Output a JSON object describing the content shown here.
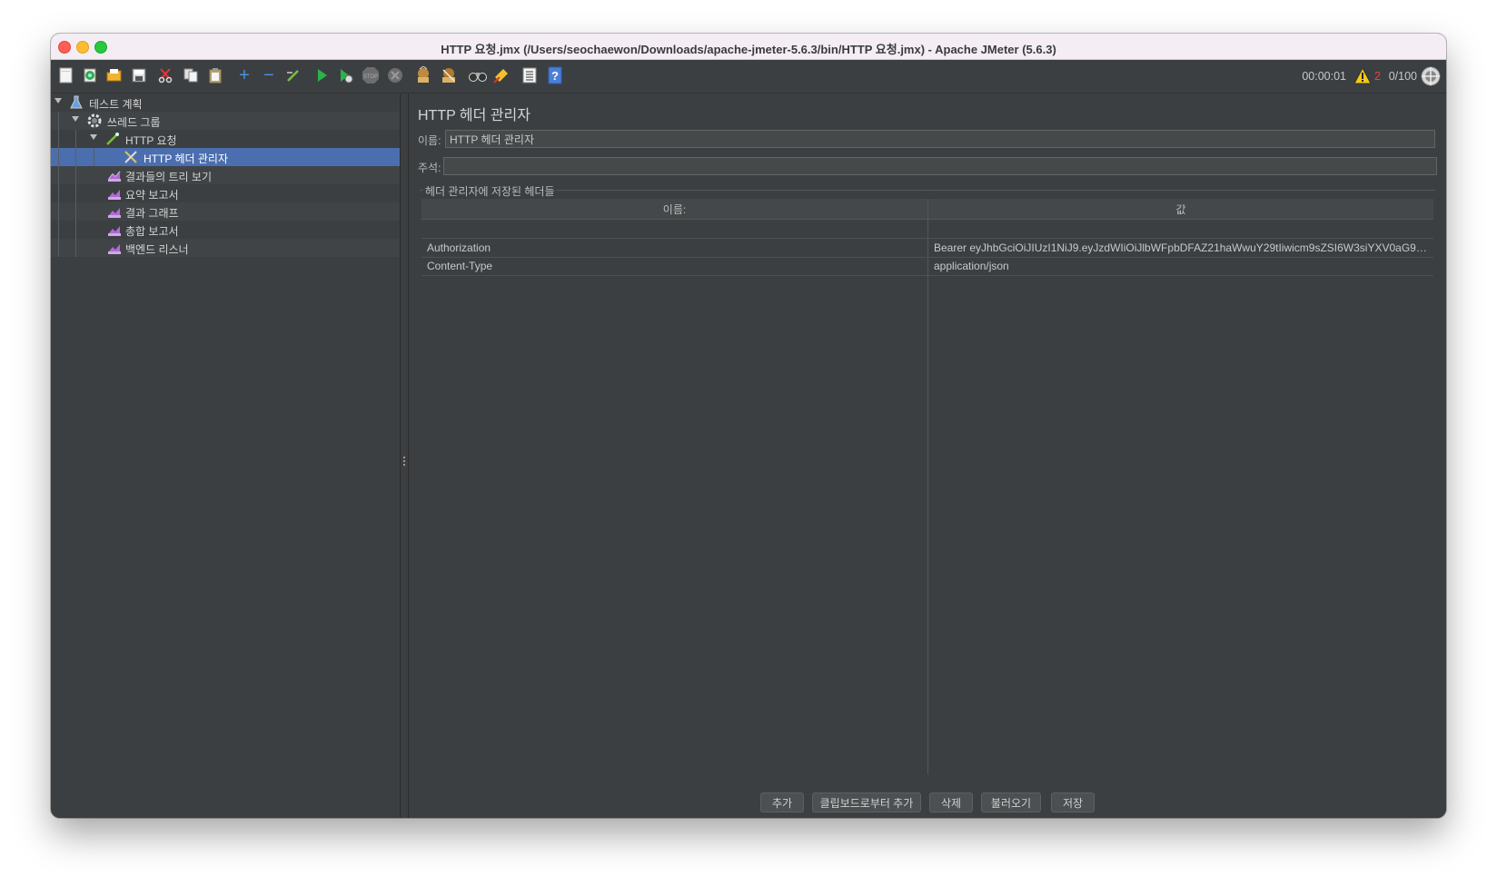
{
  "window": {
    "title": "HTTP 요청.jmx (/Users/seochaewon/Downloads/apache-jmeter-5.6.3/bin/HTTP 요청.jmx) - Apache JMeter (5.6.3)"
  },
  "toolbar": {
    "icons": [
      "new-icon",
      "templates-icon",
      "open-icon",
      "save-icon",
      "cut-icon",
      "copy-icon",
      "paste-icon",
      "expand-icon",
      "collapse-icon",
      "toggle-icon",
      "start-icon",
      "start-no-timers-icon",
      "stop-icon",
      "shutdown-icon",
      "clear-icon",
      "clear-all-icon",
      "search-icon",
      "reset-search-icon",
      "function-helper-icon",
      "help-icon"
    ],
    "timer": "00:00:01",
    "error_count": "2",
    "threads": "0/100"
  },
  "tree": {
    "items": [
      {
        "label": "테스트 계획",
        "level": 0,
        "icon": "flask-icon"
      },
      {
        "label": "쓰레드 그룹",
        "level": 1,
        "icon": "gear-icon"
      },
      {
        "label": "HTTP 요청",
        "level": 2,
        "icon": "pipette-icon"
      },
      {
        "label": "HTTP 헤더 관리자",
        "level": 3,
        "icon": "tools-icon",
        "selected": true
      },
      {
        "label": "결과들의 트리 보기",
        "level": 2,
        "icon": "chart-icon"
      },
      {
        "label": "요약 보고서",
        "level": 2,
        "icon": "chart-icon"
      },
      {
        "label": "결과 그래프",
        "level": 2,
        "icon": "chart-icon"
      },
      {
        "label": "총합 보고서",
        "level": 2,
        "icon": "chart-icon"
      },
      {
        "label": "백엔드 리스너",
        "level": 2,
        "icon": "chart-icon"
      }
    ]
  },
  "panel": {
    "title": "HTTP 헤더 관리자",
    "name_label": "이름:",
    "name_value": "HTTP 헤더 관리자",
    "comment_label": "주석:",
    "comment_value": "",
    "group_title": "헤더 관리자에 저장된 헤더들",
    "columns": [
      "이름:",
      "값"
    ],
    "rows": [
      {
        "name": "",
        "value": ""
      },
      {
        "name": "Authorization",
        "value": "Bearer eyJhbGciOiJIUzI1NiJ9.eyJzdWIiOiJlbWFpbDFAZ21haWwuY29tIiwicm9sZSI6W3siYXV0aG9y..."
      },
      {
        "name": "Content-Type",
        "value": "application/json"
      }
    ],
    "buttons": {
      "add": "추가",
      "add_clipboard": "클립보드로부터 추가",
      "delete": "삭제",
      "load": "불러오기",
      "save": "저장"
    }
  }
}
